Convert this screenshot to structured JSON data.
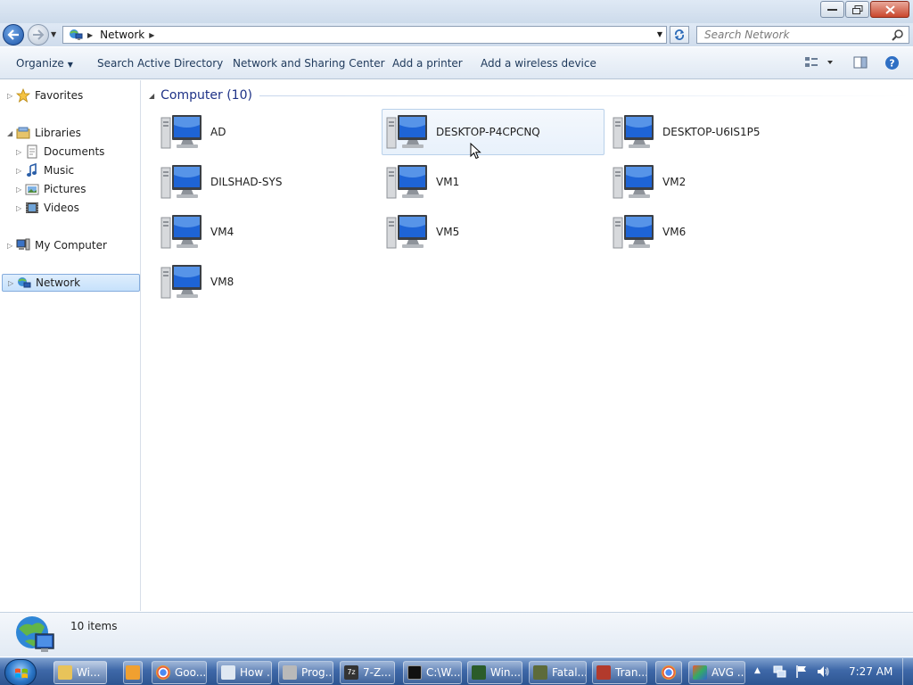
{
  "window": {
    "buttons": {
      "minimize": "▭",
      "maximize": "❐",
      "close": "✕"
    }
  },
  "address": {
    "breadcrumb": [
      "Network"
    ],
    "search_placeholder": "Search Network"
  },
  "toolbar": {
    "organize": "Organize",
    "search_ad": "Search Active Directory",
    "network_sharing": "Network and Sharing Center",
    "add_printer": "Add a printer",
    "add_wireless": "Add a wireless device"
  },
  "nav": {
    "favorites": "Favorites",
    "libraries": "Libraries",
    "documents": "Documents",
    "music": "Music",
    "pictures": "Pictures",
    "videos": "Videos",
    "my_computer": "My Computer",
    "network": "Network"
  },
  "content": {
    "group_title": "Computer (10)",
    "computers": [
      "AD",
      "DESKTOP-P4CPCNQ",
      "DESKTOP-U6IS1P5",
      "DILSHAD-SYS",
      "VM1",
      "VM2",
      "VM4",
      "VM5",
      "VM6",
      "VM8"
    ]
  },
  "status": {
    "count": "10 items"
  },
  "taskbar": {
    "items": [
      "Wi...",
      "Goo...",
      "How ...",
      "Prog...",
      "7-Z...",
      "C:\\W...",
      "Win...",
      "Fatal...",
      "Tran...",
      "AVG ..."
    ],
    "clock": "7:27 AM"
  },
  "colors": {
    "accent": "#1e3287",
    "selection": "#c6e1fb",
    "taskbar": "#3e68a8"
  }
}
